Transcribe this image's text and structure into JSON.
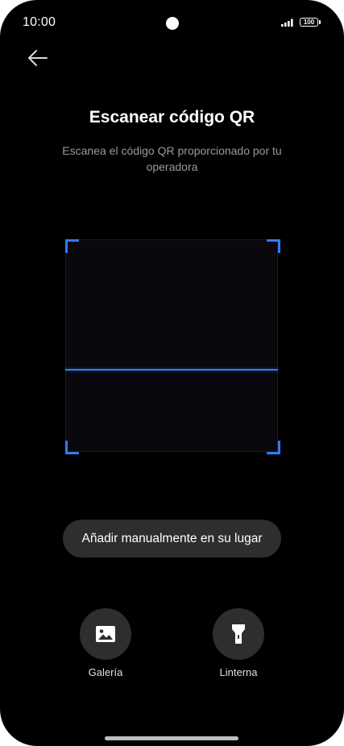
{
  "status_bar": {
    "time": "10:00",
    "battery": "100",
    "icons": [
      "camera-dot",
      "signal-icon",
      "battery-icon"
    ]
  },
  "header": {
    "back_icon": "arrow-left-icon"
  },
  "scan": {
    "title": "Escanear código QR",
    "subtitle": "Escanea el código QR proporcionado por tu operadora",
    "accent_color": "#2f7cf0"
  },
  "actions": {
    "manual_label": "Añadir manualmente en su lugar",
    "gallery": {
      "label": "Galería",
      "icon": "image-icon"
    },
    "flashlight": {
      "label": "Linterna",
      "icon": "flashlight-icon"
    }
  }
}
